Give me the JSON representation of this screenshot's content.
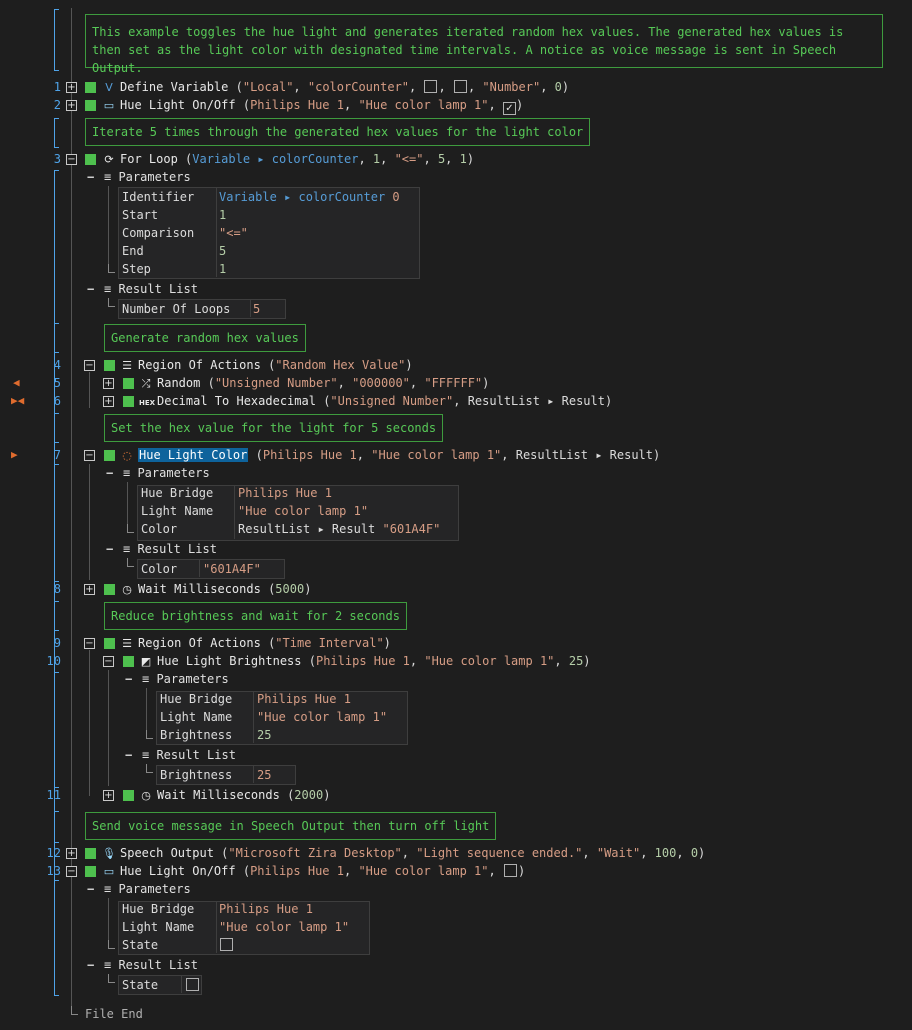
{
  "comments": {
    "c1": "This example toggles the hue light and generates iterated random hex values. The generated hex values is then set as the light color with designated time intervals. A notice as voice message is sent in Speech Output.",
    "c2": "Iterate 5 times through the generated hex values for the light color",
    "c3": "Generate random hex values",
    "c4": "Set the hex value for the light for 5 seconds",
    "c5": "Reduce brightness and wait for 2 seconds",
    "c6": "Send voice message in Speech Output then turn off light"
  },
  "lines": {
    "l1": "1",
    "l2": "2",
    "l3": "3",
    "l4": "4",
    "l5": "5",
    "l6": "6",
    "l7": "7",
    "l8": "8",
    "l9": "9",
    "l10": "10",
    "l11": "11",
    "l12": "12",
    "l13": "13"
  },
  "actions": {
    "a1": {
      "name": "Define Variable",
      "p1": "\"Local\"",
      "p2": "\"colorCounter\"",
      "p3": "\"Number\"",
      "p4": "0"
    },
    "a2": {
      "name": "Hue Light On/Off",
      "p1": "Philips Hue 1",
      "p2": "\"Hue color lamp 1\""
    },
    "a3": {
      "name": "For Loop",
      "p1": "Variable ▸ colorCounter",
      "p2": "1",
      "p3": "\"<=\"",
      "p4": "5",
      "p5": "1"
    },
    "a4": {
      "name": "Region Of Actions",
      "p1": "\"Random Hex Value\""
    },
    "a5": {
      "name": "Random",
      "p1": "\"Unsigned Number\"",
      "p2": "\"000000\"",
      "p3": "\"FFFFFF\""
    },
    "a6": {
      "name": "Decimal To Hexadecimal",
      "p1": "\"Unsigned Number\"",
      "p2": "ResultList ▸ Result"
    },
    "a7": {
      "name": "Hue Light Color",
      "p1": "Philips Hue 1",
      "p2": "\"Hue color lamp 1\"",
      "p3": "ResultList ▸ Result"
    },
    "a8": {
      "name": "Wait Milliseconds",
      "p1": "5000"
    },
    "a9": {
      "name": "Region Of Actions",
      "p1": "\"Time Interval\""
    },
    "a10": {
      "name": "Hue Light Brightness",
      "p1": "Philips Hue 1",
      "p2": "\"Hue color lamp 1\"",
      "p3": "25"
    },
    "a11": {
      "name": "Wait Milliseconds",
      "p1": "2000"
    },
    "a12": {
      "name": "Speech Output",
      "p1": "\"Microsoft Zira Desktop\"",
      "p2": "\"Light sequence ended.\"",
      "p3": "\"Wait\"",
      "p4": "100",
      "p5": "0"
    },
    "a13": {
      "name": "Hue Light On/Off",
      "p1": "Philips Hue 1",
      "p2": "\"Hue color lamp 1\""
    }
  },
  "labels": {
    "parameters": "Parameters",
    "result_list": "Result List",
    "file_end": "File End"
  },
  "params3": {
    "k1": "Identifier",
    "v1": "Variable ▸ colorCounter",
    "v1b": "0",
    "k2": "Start",
    "v2": "1",
    "k3": "Comparison",
    "v3": "\"<=\"",
    "k4": "End",
    "v4": "5",
    "k5": "Step",
    "v5": "1",
    "rk": "Number Of Loops",
    "rv": "5"
  },
  "params7": {
    "k1": "Hue Bridge",
    "v1": "Philips Hue 1",
    "k2": "Light Name",
    "v2": "\"Hue color lamp 1\"",
    "k3": "Color",
    "v3": "ResultList ▸ Result",
    "v3b": "\"601A4F\"",
    "rk": "Color",
    "rv": "\"601A4F\""
  },
  "params10": {
    "k1": "Hue Bridge",
    "v1": "Philips Hue 1",
    "k2": "Light Name",
    "v2": "\"Hue color lamp 1\"",
    "k3": "Brightness",
    "v3": "25",
    "rk": "Brightness",
    "rv": "25"
  },
  "params13": {
    "k1": "Hue Bridge",
    "v1": "Philips Hue 1",
    "k2": "Light Name",
    "v2": "\"Hue color lamp 1\"",
    "k3": "State",
    "rk": "State"
  },
  "colors": {
    "background": "#1e1e1e",
    "comment": "#57c957",
    "line_number": "#4fa3e8",
    "string": "#d69d85",
    "variable": "#569cd6",
    "selection": "#0e639c",
    "enabled": "#4ec04e"
  }
}
